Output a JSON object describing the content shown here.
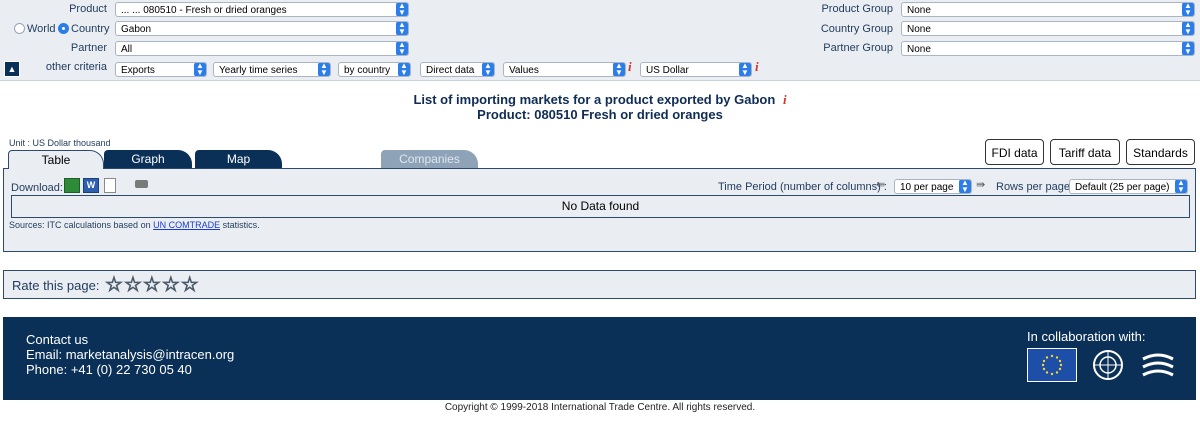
{
  "criteria": {
    "product_label": "Product",
    "product_value": "... ... 080510 - Fresh or dried oranges",
    "radio_world": "World",
    "radio_country": "Country",
    "country_value": "Gabon",
    "partner_label": "Partner",
    "partner_value": "All",
    "other_label": "other criteria",
    "other": [
      "Exports",
      "Yearly time series",
      "by country",
      "Direct data",
      "Values",
      "US Dollar"
    ],
    "product_group_label": "Product Group",
    "product_group_value": "None",
    "country_group_label": "Country Group",
    "country_group_value": "None",
    "partner_group_label": "Partner Group",
    "partner_group_value": "None",
    "info_glyph": "i"
  },
  "title": {
    "line1": "List of importing markets for a product exported by Gabon",
    "line2": "Product: 080510 Fresh or dried oranges"
  },
  "unit": "Unit : US Dollar thousand",
  "tabs": [
    "Table",
    "Graph",
    "Map",
    "Companies"
  ],
  "buttons": [
    "FDI data",
    "Tariff data",
    "Standards"
  ],
  "toolbar": {
    "download_label": "Download:",
    "time_period_label": "Time Period (number of columns) :",
    "per_page_value": "10 per page",
    "rows_label": "Rows per page",
    "rows_value": "Default (25 per page)"
  },
  "table": {
    "empty_message": "No Data found"
  },
  "sources": {
    "prefix": "Sources: ITC calculations based on ",
    "link": "UN COMTRADE",
    "suffix": " statistics."
  },
  "rating": {
    "label": "Rate this page:",
    "stars": [
      "☆",
      "☆",
      "☆",
      "☆",
      "☆"
    ]
  },
  "footer": {
    "contact_title": "Contact us",
    "email": "Email: marketanalysis@intracen.org",
    "phone": "Phone: +41 (0) 22 730 05 40",
    "collab": "In collaboration with:"
  },
  "copyright": "Copyright © 1999-2018 International Trade Centre. All rights reserved.",
  "colors": {
    "navy": "#0b3057",
    "accent": "#2b7de9",
    "info": "#d2352a",
    "tab_disabled": "#8fa3b8"
  }
}
